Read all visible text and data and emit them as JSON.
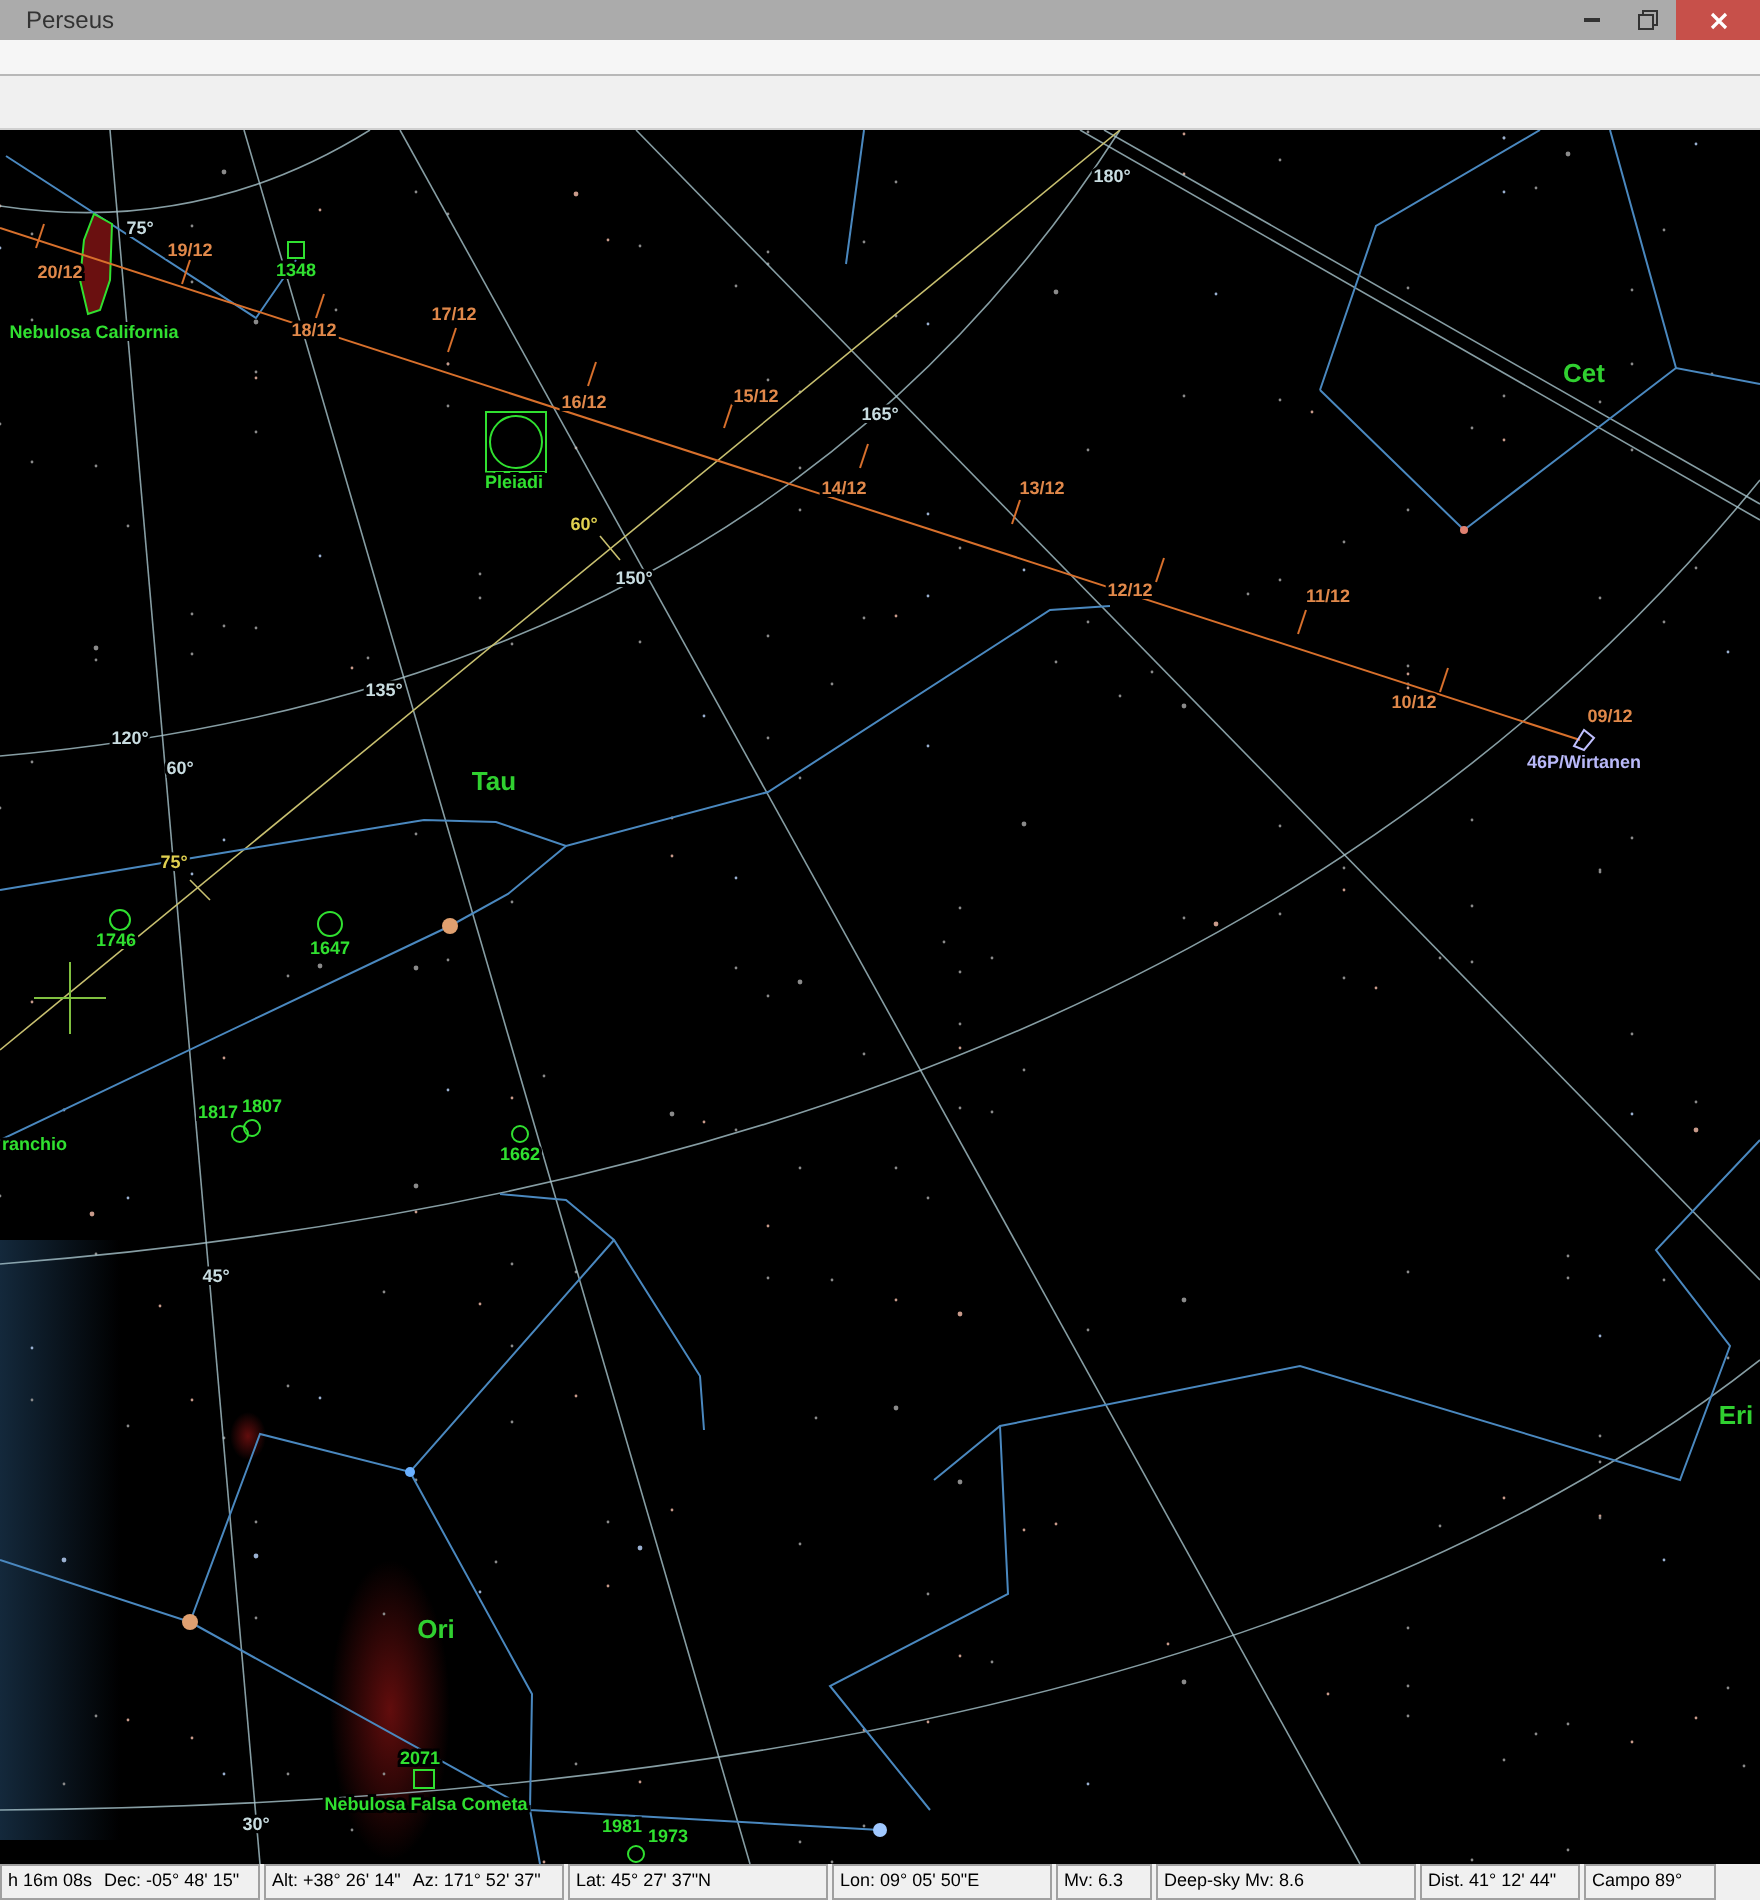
{
  "window": {
    "title": "Perseus"
  },
  "sky_map": {
    "comet_path": {
      "date_marks": [
        "20/12",
        "19/12",
        "18/12",
        "17/12",
        "16/12",
        "15/12",
        "14/12",
        "13/12",
        "12/12",
        "11/12",
        "10/12",
        "09/12"
      ],
      "comet_label": "46P/Wirtanen"
    },
    "grid_labels": [
      "75°",
      "180°",
      "165°",
      "150°",
      "135°",
      "120°",
      "60°",
      "45°",
      "30°"
    ],
    "ecliptic_labels": [
      "60°",
      "75°"
    ],
    "constellation_labels": [
      "Cet",
      "Tau",
      "Ori",
      "Eri"
    ],
    "deep_sky_labels": [
      "Nebulosa California",
      "1348",
      "Pleiadi",
      "1746",
      "1647",
      "1817",
      "1807",
      "1662",
      "ranchio",
      "2071",
      "Nebulosa Falsa Cometa",
      "1981",
      "1973"
    ]
  },
  "status_bar": [
    {
      "texts": [
        "h 16m 08s",
        "Dec: -05° 48' 15\""
      ]
    },
    {
      "texts": [
        "Alt: +38° 26' 14\"",
        "Az: 171° 52' 37\""
      ]
    },
    {
      "texts": [
        "Lat: 45° 27' 37\"N"
      ]
    },
    {
      "texts": [
        "Lon: 09° 05' 50\"E"
      ]
    },
    {
      "texts": [
        "Mv:  6.3"
      ]
    },
    {
      "texts": [
        "Deep-sky Mv:  8.6"
      ]
    },
    {
      "texts": [
        "Dist. 41° 12' 44\""
      ]
    },
    {
      "texts": [
        "Campo 89°"
      ]
    }
  ]
}
